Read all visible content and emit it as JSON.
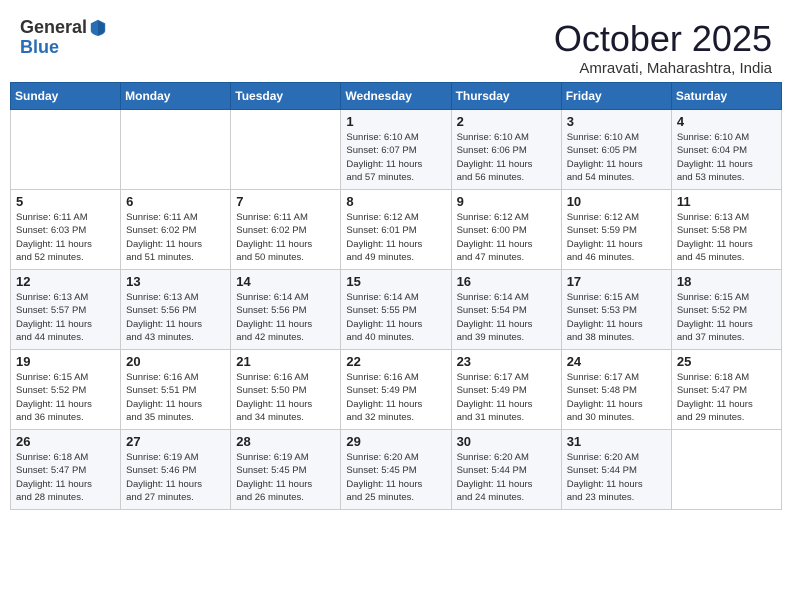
{
  "header": {
    "logo_general": "General",
    "logo_blue": "Blue",
    "month": "October 2025",
    "location": "Amravati, Maharashtra, India"
  },
  "days_of_week": [
    "Sunday",
    "Monday",
    "Tuesday",
    "Wednesday",
    "Thursday",
    "Friday",
    "Saturday"
  ],
  "weeks": [
    [
      {
        "num": "",
        "info": ""
      },
      {
        "num": "",
        "info": ""
      },
      {
        "num": "",
        "info": ""
      },
      {
        "num": "1",
        "info": "Sunrise: 6:10 AM\nSunset: 6:07 PM\nDaylight: 11 hours\nand 57 minutes."
      },
      {
        "num": "2",
        "info": "Sunrise: 6:10 AM\nSunset: 6:06 PM\nDaylight: 11 hours\nand 56 minutes."
      },
      {
        "num": "3",
        "info": "Sunrise: 6:10 AM\nSunset: 6:05 PM\nDaylight: 11 hours\nand 54 minutes."
      },
      {
        "num": "4",
        "info": "Sunrise: 6:10 AM\nSunset: 6:04 PM\nDaylight: 11 hours\nand 53 minutes."
      }
    ],
    [
      {
        "num": "5",
        "info": "Sunrise: 6:11 AM\nSunset: 6:03 PM\nDaylight: 11 hours\nand 52 minutes."
      },
      {
        "num": "6",
        "info": "Sunrise: 6:11 AM\nSunset: 6:02 PM\nDaylight: 11 hours\nand 51 minutes."
      },
      {
        "num": "7",
        "info": "Sunrise: 6:11 AM\nSunset: 6:02 PM\nDaylight: 11 hours\nand 50 minutes."
      },
      {
        "num": "8",
        "info": "Sunrise: 6:12 AM\nSunset: 6:01 PM\nDaylight: 11 hours\nand 49 minutes."
      },
      {
        "num": "9",
        "info": "Sunrise: 6:12 AM\nSunset: 6:00 PM\nDaylight: 11 hours\nand 47 minutes."
      },
      {
        "num": "10",
        "info": "Sunrise: 6:12 AM\nSunset: 5:59 PM\nDaylight: 11 hours\nand 46 minutes."
      },
      {
        "num": "11",
        "info": "Sunrise: 6:13 AM\nSunset: 5:58 PM\nDaylight: 11 hours\nand 45 minutes."
      }
    ],
    [
      {
        "num": "12",
        "info": "Sunrise: 6:13 AM\nSunset: 5:57 PM\nDaylight: 11 hours\nand 44 minutes."
      },
      {
        "num": "13",
        "info": "Sunrise: 6:13 AM\nSunset: 5:56 PM\nDaylight: 11 hours\nand 43 minutes."
      },
      {
        "num": "14",
        "info": "Sunrise: 6:14 AM\nSunset: 5:56 PM\nDaylight: 11 hours\nand 42 minutes."
      },
      {
        "num": "15",
        "info": "Sunrise: 6:14 AM\nSunset: 5:55 PM\nDaylight: 11 hours\nand 40 minutes."
      },
      {
        "num": "16",
        "info": "Sunrise: 6:14 AM\nSunset: 5:54 PM\nDaylight: 11 hours\nand 39 minutes."
      },
      {
        "num": "17",
        "info": "Sunrise: 6:15 AM\nSunset: 5:53 PM\nDaylight: 11 hours\nand 38 minutes."
      },
      {
        "num": "18",
        "info": "Sunrise: 6:15 AM\nSunset: 5:52 PM\nDaylight: 11 hours\nand 37 minutes."
      }
    ],
    [
      {
        "num": "19",
        "info": "Sunrise: 6:15 AM\nSunset: 5:52 PM\nDaylight: 11 hours\nand 36 minutes."
      },
      {
        "num": "20",
        "info": "Sunrise: 6:16 AM\nSunset: 5:51 PM\nDaylight: 11 hours\nand 35 minutes."
      },
      {
        "num": "21",
        "info": "Sunrise: 6:16 AM\nSunset: 5:50 PM\nDaylight: 11 hours\nand 34 minutes."
      },
      {
        "num": "22",
        "info": "Sunrise: 6:16 AM\nSunset: 5:49 PM\nDaylight: 11 hours\nand 32 minutes."
      },
      {
        "num": "23",
        "info": "Sunrise: 6:17 AM\nSunset: 5:49 PM\nDaylight: 11 hours\nand 31 minutes."
      },
      {
        "num": "24",
        "info": "Sunrise: 6:17 AM\nSunset: 5:48 PM\nDaylight: 11 hours\nand 30 minutes."
      },
      {
        "num": "25",
        "info": "Sunrise: 6:18 AM\nSunset: 5:47 PM\nDaylight: 11 hours\nand 29 minutes."
      }
    ],
    [
      {
        "num": "26",
        "info": "Sunrise: 6:18 AM\nSunset: 5:47 PM\nDaylight: 11 hours\nand 28 minutes."
      },
      {
        "num": "27",
        "info": "Sunrise: 6:19 AM\nSunset: 5:46 PM\nDaylight: 11 hours\nand 27 minutes."
      },
      {
        "num": "28",
        "info": "Sunrise: 6:19 AM\nSunset: 5:45 PM\nDaylight: 11 hours\nand 26 minutes."
      },
      {
        "num": "29",
        "info": "Sunrise: 6:20 AM\nSunset: 5:45 PM\nDaylight: 11 hours\nand 25 minutes."
      },
      {
        "num": "30",
        "info": "Sunrise: 6:20 AM\nSunset: 5:44 PM\nDaylight: 11 hours\nand 24 minutes."
      },
      {
        "num": "31",
        "info": "Sunrise: 6:20 AM\nSunset: 5:44 PM\nDaylight: 11 hours\nand 23 minutes."
      },
      {
        "num": "",
        "info": ""
      }
    ]
  ]
}
